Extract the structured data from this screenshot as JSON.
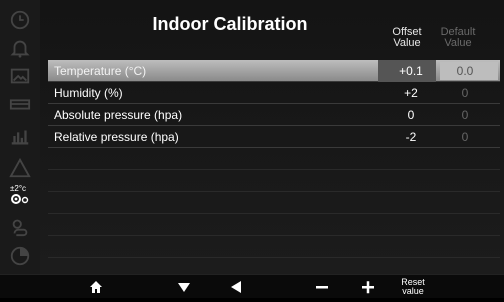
{
  "title": "Indoor Calibration",
  "columns": {
    "offset_line1": "Offset",
    "offset_line2": "Value",
    "default_line1": "Default",
    "default_line2": "Value"
  },
  "rows": [
    {
      "label": "Temperature (°C)",
      "offset": "+0.1",
      "default": "0.0"
    },
    {
      "label": "Humidity (%)",
      "offset": "+2",
      "default": "0"
    },
    {
      "label": "Absolute pressure (hpa)",
      "offset": "0",
      "default": "0"
    },
    {
      "label": "Relative pressure (hpa)",
      "offset": "-2",
      "default": "0"
    }
  ],
  "sidebar": {
    "icons": [
      "clock-icon",
      "bell-icon",
      "image-icon",
      "card-icon",
      "chart-icon",
      "warning-icon",
      "calibration-icon",
      "weather-icon",
      "pie-icon"
    ],
    "calibration_label": "±2°c"
  },
  "toolbar": {
    "reset_line1": "Reset",
    "reset_line2": "value"
  }
}
